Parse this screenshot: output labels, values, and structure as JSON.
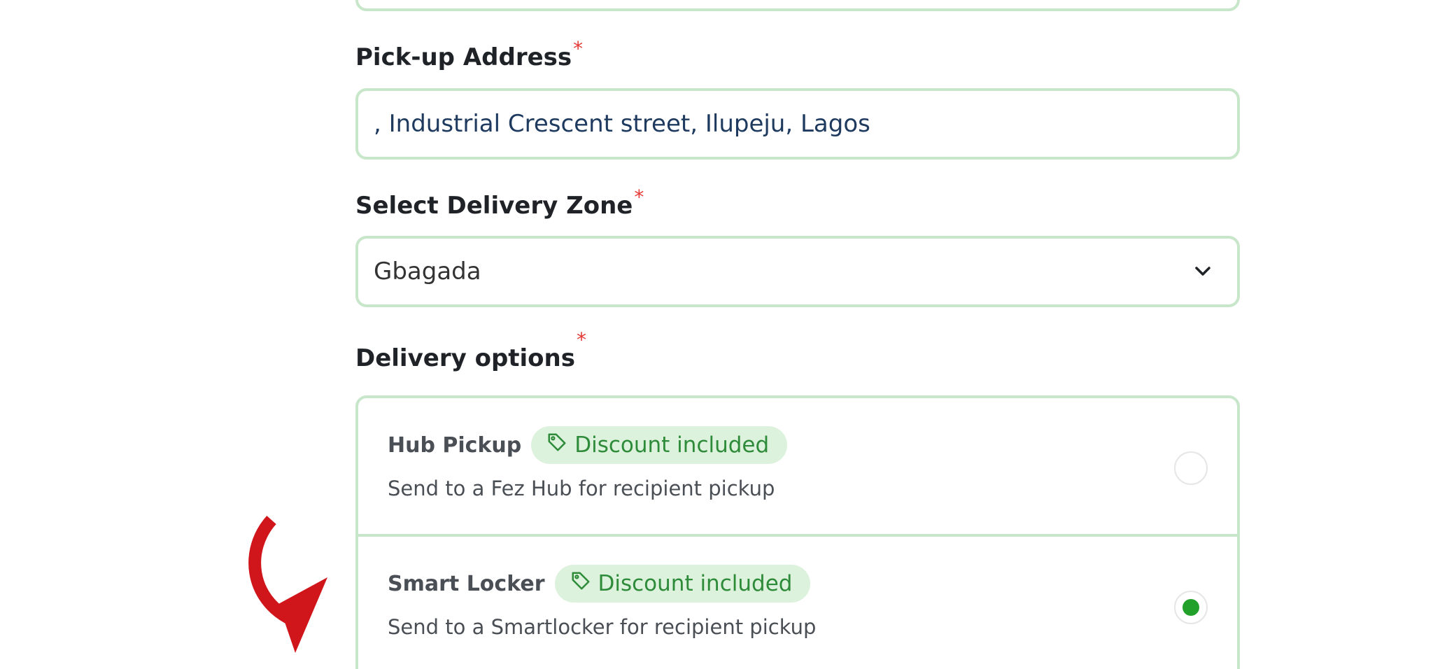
{
  "form": {
    "pickup": {
      "label": "Pick-up Address",
      "required_mark": "*",
      "value": ", Industrial Crescent street, Ilupeju, Lagos"
    },
    "zone": {
      "label": "Select Delivery Zone",
      "required_mark": "*",
      "selected": "Gbagada"
    },
    "delivery_options": {
      "label": "Delivery options",
      "required_mark": "*",
      "items": [
        {
          "title": "Hub Pickup",
          "badge": "Discount included",
          "description": "Send to a Fez Hub for recipient pickup",
          "selected": false
        },
        {
          "title": "Smart Locker",
          "badge": "Discount included",
          "description": "Send to a Smartlocker for recipient pickup",
          "selected": true
        }
      ]
    }
  },
  "colors": {
    "border": "#c8e6c9",
    "required": "#e53935",
    "badge_bg": "#dcf2dc",
    "badge_text": "#2e8b3a",
    "radio_selected": "#22a12a",
    "annotation_arrow": "#d0161b"
  },
  "icons": {
    "badge_icon": "tag-icon",
    "select_icon": "chevron-down-icon",
    "annotation": "curved-arrow-icon"
  }
}
